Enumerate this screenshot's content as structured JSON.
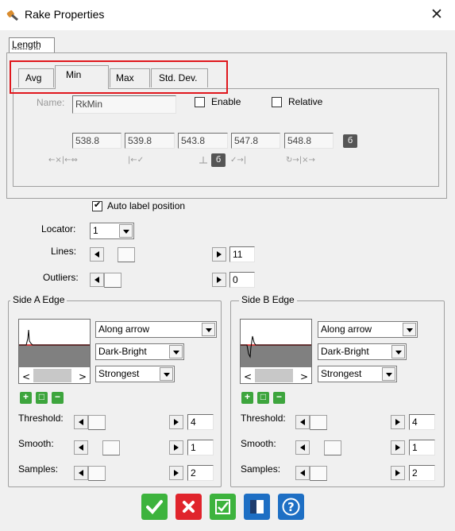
{
  "window": {
    "title": "Rake Properties",
    "close": "✕"
  },
  "top_tab": "Length",
  "tabs": [
    {
      "label": "Avg"
    },
    {
      "label": "Min"
    },
    {
      "label": "Max"
    },
    {
      "label": "Std. Dev."
    }
  ],
  "name_field": {
    "label": "Name:",
    "value": "RkMin"
  },
  "enable": {
    "label": "Enable",
    "checked": false
  },
  "relative": {
    "label": "Relative",
    "checked": false
  },
  "values": [
    "538.8",
    "539.8",
    "543.8",
    "547.8",
    "548.8"
  ],
  "lock_glyph": "б",
  "auto_label": {
    "label": "Auto label position",
    "checked": true
  },
  "locator": {
    "label": "Locator:",
    "value": "1"
  },
  "lines": {
    "label": "Lines:",
    "value": "11"
  },
  "outliers": {
    "label": "Outliers:",
    "value": "0"
  },
  "side_a": {
    "title": "Side A Edge",
    "direction": "Along arrow",
    "polarity": "Dark-Bright",
    "selection": "Strongest",
    "threshold": {
      "label": "Threshold:",
      "value": "4"
    },
    "smooth": {
      "label": "Smooth:",
      "value": "1"
    },
    "samples": {
      "label": "Samples:",
      "value": "2"
    }
  },
  "side_b": {
    "title": "Side B Edge",
    "direction": "Along arrow",
    "polarity": "Dark-Bright",
    "selection": "Strongest",
    "threshold": {
      "label": "Threshold:",
      "value": "4"
    },
    "smooth": {
      "label": "Smooth:",
      "value": "1"
    },
    "samples": {
      "label": "Samples:",
      "value": "2"
    }
  },
  "colors": {
    "highlight": "#e0171d",
    "ok": "#3db33d",
    "cancel": "#e0242c",
    "info": "#1e6fc4",
    "edge_line": "#e02020"
  }
}
